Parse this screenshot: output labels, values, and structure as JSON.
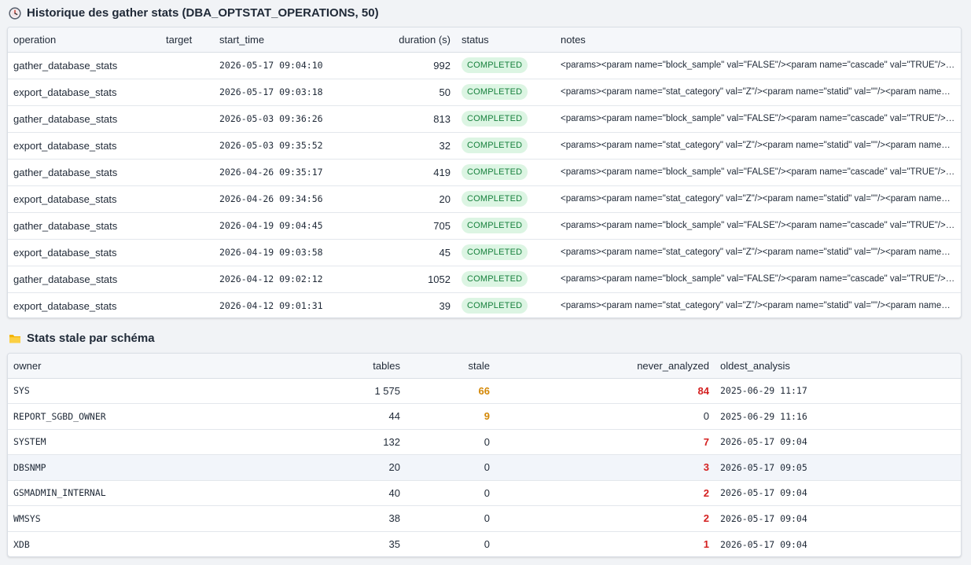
{
  "history": {
    "title": "Historique des gather stats (DBA_OPTSTAT_OPERATIONS, 50)",
    "icon": "clock-icon",
    "columns": {
      "operation": "operation",
      "target": "target",
      "start_time": "start_time",
      "duration": "duration (s)",
      "status": "status",
      "notes": "notes"
    },
    "rows": [
      {
        "operation": "gather_database_stats",
        "target": "",
        "start_time": "2026-05-17 09:04:10",
        "duration": "992",
        "status": "COMPLETED",
        "notes": "<params><param name=\"block_sample\" val=\"FALSE\"/><param name=\"cascade\" val=\"TRUE\"/><param name=\"concurrent\" val=\"FALSE\"/>"
      },
      {
        "operation": "export_database_stats",
        "target": "",
        "start_time": "2026-05-17 09:03:18",
        "duration": "50",
        "status": "COMPLETED",
        "notes": "<params><param name=\"stat_category\" val=\"Z\"/><param name=\"statid\" val=\"\"/><param name=\"statown\" val=\"\"/>"
      },
      {
        "operation": "gather_database_stats",
        "target": "",
        "start_time": "2026-05-03 09:36:26",
        "duration": "813",
        "status": "COMPLETED",
        "notes": "<params><param name=\"block_sample\" val=\"FALSE\"/><param name=\"cascade\" val=\"TRUE\"/><param name=\"concurrent\" val=\"FALSE\"/>"
      },
      {
        "operation": "export_database_stats",
        "target": "",
        "start_time": "2026-05-03 09:35:52",
        "duration": "32",
        "status": "COMPLETED",
        "notes": "<params><param name=\"stat_category\" val=\"Z\"/><param name=\"statid\" val=\"\"/><param name=\"statown\" val=\"\"/>"
      },
      {
        "operation": "gather_database_stats",
        "target": "",
        "start_time": "2026-04-26 09:35:17",
        "duration": "419",
        "status": "COMPLETED",
        "notes": "<params><param name=\"block_sample\" val=\"FALSE\"/><param name=\"cascade\" val=\"TRUE\"/><param name=\"concurrent\" val=\"FALSE\"/>"
      },
      {
        "operation": "export_database_stats",
        "target": "",
        "start_time": "2026-04-26 09:34:56",
        "duration": "20",
        "status": "COMPLETED",
        "notes": "<params><param name=\"stat_category\" val=\"Z\"/><param name=\"statid\" val=\"\"/><param name=\"statown\" val=\"\"/>"
      },
      {
        "operation": "gather_database_stats",
        "target": "",
        "start_time": "2026-04-19 09:04:45",
        "duration": "705",
        "status": "COMPLETED",
        "notes": "<params><param name=\"block_sample\" val=\"FALSE\"/><param name=\"cascade\" val=\"TRUE\"/><param name=\"concurrent\" val=\"FALSE\"/>"
      },
      {
        "operation": "export_database_stats",
        "target": "",
        "start_time": "2026-04-19 09:03:58",
        "duration": "45",
        "status": "COMPLETED",
        "notes": "<params><param name=\"stat_category\" val=\"Z\"/><param name=\"statid\" val=\"\"/><param name=\"statown\" val=\"\"/>"
      },
      {
        "operation": "gather_database_stats",
        "target": "",
        "start_time": "2026-04-12 09:02:12",
        "duration": "1052",
        "status": "COMPLETED",
        "notes": "<params><param name=\"block_sample\" val=\"FALSE\"/><param name=\"cascade\" val=\"TRUE\"/><param name=\"concurrent\" val=\"FALSE\"/>"
      },
      {
        "operation": "export_database_stats",
        "target": "",
        "start_time": "2026-04-12 09:01:31",
        "duration": "39",
        "status": "COMPLETED",
        "notes": "<params><param name=\"stat_category\" val=\"Z\"/><param name=\"statid\" val=\"\"/><param name=\"statown\" val=\"\"/>"
      }
    ]
  },
  "stale": {
    "title": "Stats stale par schéma",
    "icon": "folder-icon",
    "columns": {
      "owner": "owner",
      "tables": "tables",
      "stale": "stale",
      "never_analyzed": "never_analyzed",
      "oldest_analysis": "oldest_analysis"
    },
    "rows": [
      {
        "owner": "SYS",
        "tables": "1 575",
        "stale": "66",
        "never_analyzed": "84",
        "oldest_analysis": "2025-06-29 11:17"
      },
      {
        "owner": "REPORT_SGBD_OWNER",
        "tables": "44",
        "stale": "9",
        "never_analyzed": "0",
        "oldest_analysis": "2025-06-29 11:16"
      },
      {
        "owner": "SYSTEM",
        "tables": "132",
        "stale": "0",
        "never_analyzed": "7",
        "oldest_analysis": "2026-05-17 09:04"
      },
      {
        "owner": "DBSNMP",
        "tables": "20",
        "stale": "0",
        "never_analyzed": "3",
        "oldest_analysis": "2026-05-17 09:05"
      },
      {
        "owner": "GSMADMIN_INTERNAL",
        "tables": "40",
        "stale": "0",
        "never_analyzed": "2",
        "oldest_analysis": "2026-05-17 09:04"
      },
      {
        "owner": "WMSYS",
        "tables": "38",
        "stale": "0",
        "never_analyzed": "2",
        "oldest_analysis": "2026-05-17 09:04"
      },
      {
        "owner": "XDB",
        "tables": "35",
        "stale": "0",
        "never_analyzed": "1",
        "oldest_analysis": "2026-05-17 09:04"
      }
    ]
  },
  "colors": {
    "badge_bg": "#dcf5e3",
    "badge_text": "#16803c",
    "warn": "#d48806",
    "critical": "#d42020"
  }
}
